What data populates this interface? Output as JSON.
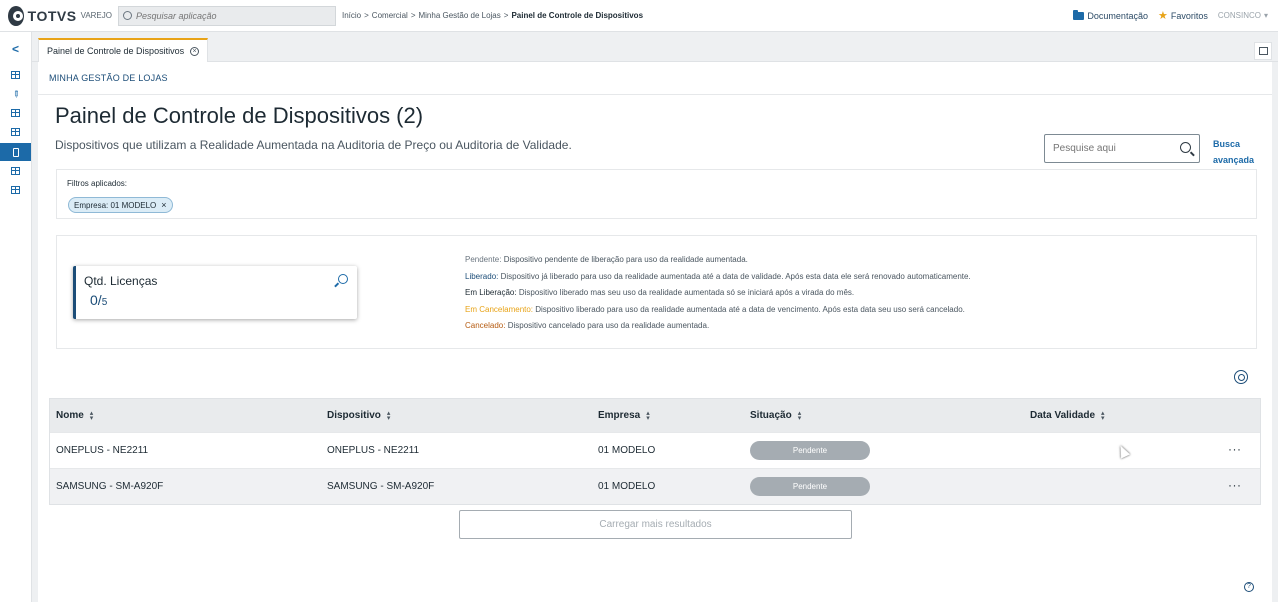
{
  "brand": {
    "name": "TOTVS",
    "sub": "VAREJO"
  },
  "app_search": {
    "placeholder": "Pesquisar aplicação"
  },
  "breadcrumb": [
    "Início",
    ">",
    "Comercial",
    ">",
    "Minha Gestão de Lojas",
    ">",
    "Painel de Controle de Dispositivos"
  ],
  "top_links": {
    "docs": "Documentação",
    "favorites": "Favoritos",
    "tenant": "CONSINCO",
    "tenant_caret": "▾"
  },
  "tab": {
    "label": "Painel de Controle de Dispositivos",
    "close": "×"
  },
  "section": "MINHA GESTÃO DE LOJAS",
  "page": {
    "title": "Painel de Controle de Dispositivos (2)",
    "subtitle": "Dispositivos que utilizam a Realidade Aumentada na Auditoria de Preço ou Auditoria de Validade."
  },
  "search": {
    "placeholder": "Pesquise aqui",
    "advanced_line1": "Busca",
    "advanced_line2": "avançada"
  },
  "filters": {
    "label": "Filtros aplicados:",
    "chip": "Empresa: 01 MODELO",
    "chip_close": "×"
  },
  "license": {
    "title": "Qtd. Licenças",
    "used": "0/",
    "total": "5"
  },
  "legend": [
    {
      "key": "Pendente:",
      "text": " Dispositivo pendente de liberação para uso da realidade aumentada."
    },
    {
      "key": "Liberado:",
      "text": " Dispositivo já liberado para uso da realidade aumentada até a data de validade. Após esta data ele será renovado automaticamente."
    },
    {
      "key": "Em Liberação:",
      "text": " Dispositivo liberado mas seu uso da realidade aumentada só se iniciará após a virada do mês."
    },
    {
      "key": "Em Cancelamento:",
      "text": " Dispositivo liberado para uso da realidade aumentada até a data de vencimento. Após esta data seu uso será cancelado."
    },
    {
      "key": "Cancelado:",
      "text": " Dispositivo cancelado para uso da realidade aumentada."
    }
  ],
  "table": {
    "headers": [
      "Nome",
      "Dispositivo",
      "Empresa",
      "Situação",
      "Data Validade"
    ],
    "rows": [
      {
        "nome": "ONEPLUS - NE2211",
        "dispositivo": "ONEPLUS - NE2211",
        "empresa": "01 MODELO",
        "situacao": "Pendente",
        "validade": "",
        "more": "···"
      },
      {
        "nome": "SAMSUNG - SM-A920F",
        "dispositivo": "SAMSUNG - SM-A920F",
        "empresa": "01 MODELO",
        "situacao": "Pendente",
        "validade": "",
        "more": "···"
      }
    ]
  },
  "load_more": "Carregar mais resultados",
  "help": "?",
  "colors": {
    "accent": "#1c6aa8",
    "tab_accent": "#e8a317",
    "pill": "#a5acb2"
  }
}
